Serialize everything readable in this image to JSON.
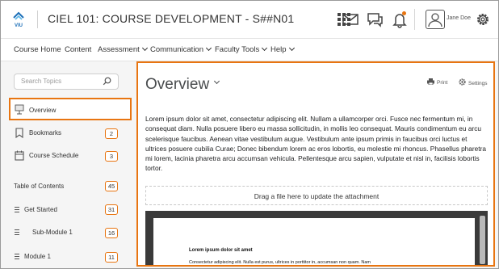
{
  "header": {
    "logo_text": "VIU",
    "course_title": "CIEL 101: COURSE DEVELOPMENT - S##N01",
    "user_name": "Jane Doe",
    "notification_dot_color": "#e87511"
  },
  "nav": {
    "items": [
      {
        "label": "Course Home",
        "has_menu": false
      },
      {
        "label": "Content",
        "has_menu": false
      },
      {
        "label": "Assessment",
        "has_menu": true
      },
      {
        "label": "Communication",
        "has_menu": true
      },
      {
        "label": "Faculty Tools",
        "has_menu": true
      },
      {
        "label": "Help",
        "has_menu": true
      }
    ]
  },
  "sidebar": {
    "search_placeholder": "Search Topics",
    "items": [
      {
        "label": "Overview",
        "icon": "overview-icon",
        "active": true
      },
      {
        "label": "Bookmarks",
        "icon": "bookmark-icon",
        "count": "2"
      },
      {
        "label": "Course Schedule",
        "icon": "calendar-icon",
        "count": "3"
      }
    ],
    "toc_label": "Table of Contents",
    "toc_count": "45",
    "modules": [
      {
        "label": "Get Started",
        "count": "31"
      },
      {
        "label": "Sub-Module 1",
        "count": "16"
      },
      {
        "label": "Module 1",
        "count": "11"
      }
    ]
  },
  "main": {
    "title": "Overview",
    "print_label": "Print",
    "settings_label": "Settings",
    "body": "Lorem ipsum dolor sit amet, consectetur adipiscing elit. Nullam a ullamcorper orci. Fusce nec fermentum mi, in consequat diam. Nulla posuere libero eu massa sollicitudin, in mollis leo consequat. Mauris condimentum eu arcu scelerisque faucibus. Aenean vitae vestibulum augue. Vestibulum ante ipsum primis in faucibus orci luctus et ultrices posuere cubilia Curae; Donec bibendum lorem ac eros lobortis, eu molestie mi rhoncus. Phasellus pharetra mi lorem, lacinia pharetra arcu accumsan vehicula. Pellentesque arcu sapien, vulputate et nisl in, facilisis lobortis tortor.",
    "dropzone_text": "Drag a file here to update the attachment",
    "doc_heading": "Lorem ipsum dolor sit amet",
    "doc_text": "Consectetur adipiscing elit. Nulla est purus, ultrices in porttitor in, accumsan non quam. Nam"
  },
  "colors": {
    "accent": "#e87511"
  }
}
